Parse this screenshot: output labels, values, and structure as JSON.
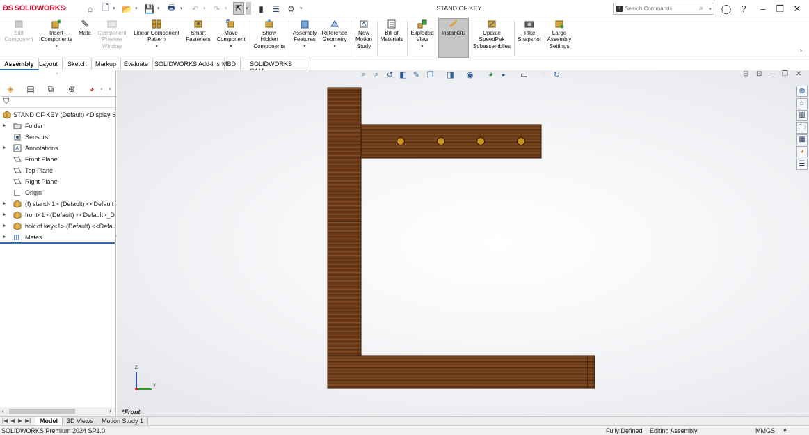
{
  "app": {
    "logo_text": "SOLIDWORKS",
    "title": "STAND OF KEY",
    "search_placeholder": "Search Commands"
  },
  "command_manager": [
    {
      "label": "Edit\nComponent",
      "icon": "edit-component-icon",
      "disabled": true
    },
    {
      "label": "Insert\nComponents",
      "icon": "insert-components-icon",
      "disabled": false
    },
    {
      "label": "Mate",
      "icon": "mate-icon",
      "disabled": false
    },
    {
      "label": "Component\nPreview\nWindow",
      "icon": "component-preview-icon",
      "disabled": true
    },
    {
      "label": "Linear Component\nPattern",
      "icon": "linear-pattern-icon",
      "disabled": false
    },
    {
      "label": "Smart\nFasteners",
      "icon": "smart-fasteners-icon",
      "disabled": false
    },
    {
      "label": "Move\nComponent",
      "icon": "move-component-icon",
      "disabled": false
    },
    {
      "label": "Show\nHidden\nComponents",
      "icon": "show-hidden-icon",
      "disabled": false
    },
    {
      "label": "Assembly\nFeatures",
      "icon": "assembly-features-icon",
      "disabled": false
    },
    {
      "label": "Reference\nGeometry",
      "icon": "reference-geometry-icon",
      "disabled": false
    },
    {
      "label": "New\nMotion\nStudy",
      "icon": "motion-study-icon",
      "disabled": false
    },
    {
      "label": "Bill of\nMaterials",
      "icon": "bom-icon",
      "disabled": false
    },
    {
      "label": "Exploded\nView",
      "icon": "exploded-view-icon",
      "disabled": false
    },
    {
      "label": "Instant3D",
      "icon": "instant3d-icon",
      "disabled": false
    },
    {
      "label": "Update\nSpeedPak\nSubassemblies",
      "icon": "speedpak-icon",
      "disabled": false
    },
    {
      "label": "Take\nSnapshot",
      "icon": "snapshot-icon",
      "disabled": false
    },
    {
      "label": "Large\nAssembly\nSettings",
      "icon": "large-assembly-icon",
      "disabled": false
    }
  ],
  "tabs": [
    "Assembly",
    "Layout",
    "Sketch",
    "Markup",
    "Evaluate",
    "SOLIDWORKS Add-Ins",
    "MBD",
    "SOLIDWORKS CAM"
  ],
  "tree": {
    "root": "STAND OF KEY (Default) <Display Stat",
    "items": [
      {
        "label": "Folder",
        "icon": "folder-icon",
        "expandable": true
      },
      {
        "label": "Sensors",
        "icon": "sensors-icon",
        "expandable": false
      },
      {
        "label": "Annotations",
        "icon": "annotations-icon",
        "expandable": true
      },
      {
        "label": "Front Plane",
        "icon": "plane-icon",
        "expandable": false
      },
      {
        "label": "Top Plane",
        "icon": "plane-icon",
        "expandable": false
      },
      {
        "label": "Right Plane",
        "icon": "plane-icon",
        "expandable": false
      },
      {
        "label": "Origin",
        "icon": "origin-icon",
        "expandable": false
      },
      {
        "label": "(f) stand<1> (Default) <<Default>",
        "icon": "part-icon",
        "expandable": true
      },
      {
        "label": "front<1> (Default) <<Default>_Di",
        "icon": "part-icon",
        "expandable": true
      },
      {
        "label": "hok of key<1> (Default) <<Defau",
        "icon": "part-icon",
        "expandable": true
      },
      {
        "label": "Mates",
        "icon": "mates-icon",
        "expandable": true
      }
    ]
  },
  "graphics": {
    "view_name": "*Front",
    "triad": {
      "x": "Y",
      "z": "Z"
    },
    "wood_color": "#6b3a18"
  },
  "bottom_tabs": [
    "Model",
    "3D Views",
    "Motion Study 1"
  ],
  "status": {
    "product": "SOLIDWORKS Premium 2024 SP1.0",
    "definition": "Fully Defined",
    "mode": "Editing Assembly",
    "units": "MMGS",
    "units_caret": "▲"
  }
}
